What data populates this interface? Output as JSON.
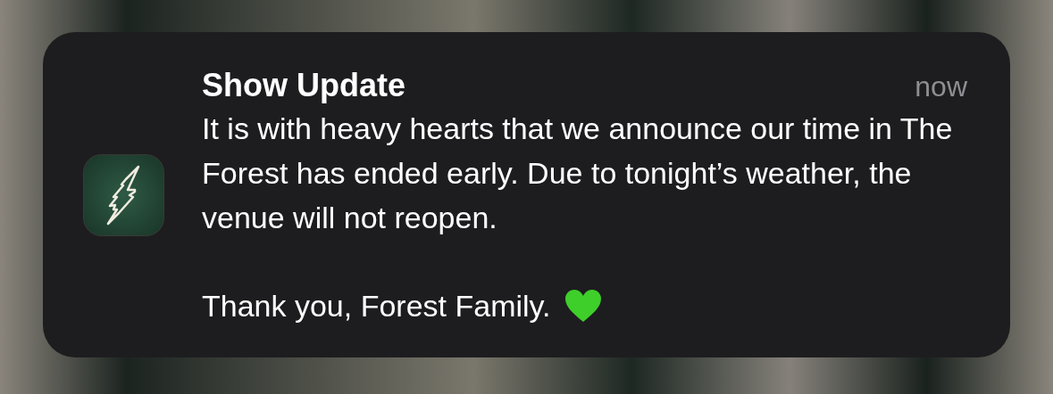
{
  "notification": {
    "title": "Show Update",
    "time": "now",
    "paragraphs": [
      "It is with heavy hearts that we announce our time in The Forest has ended early. Due to tonight’s weather, the venue will not reopen.",
      "Thank you, Forest Family."
    ]
  }
}
